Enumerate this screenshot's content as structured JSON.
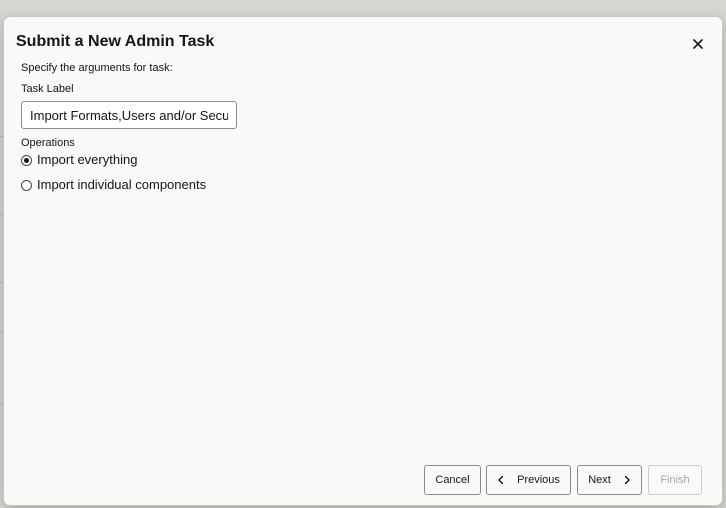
{
  "dialog": {
    "title": "Submit a New Admin Task",
    "close_icon": "close-icon",
    "instruction": "Specify the arguments for task:",
    "task_label": {
      "label": "Task Label",
      "value": "Import Formats,Users and/or Secu"
    },
    "operations": {
      "label": "Operations",
      "options": [
        {
          "label": "Import everything",
          "selected": true
        },
        {
          "label": "Import individual components",
          "selected": false
        }
      ]
    },
    "footer": {
      "cancel_label": "Cancel",
      "previous_label": "Previous",
      "next_label": "Next",
      "finish_label": "Finish",
      "finish_enabled": false
    }
  },
  "colors": {
    "dialog_background": "#fbf9f8",
    "text": "#161513",
    "border": "#8f8b85",
    "disabled_text": "#a9a6a1"
  }
}
